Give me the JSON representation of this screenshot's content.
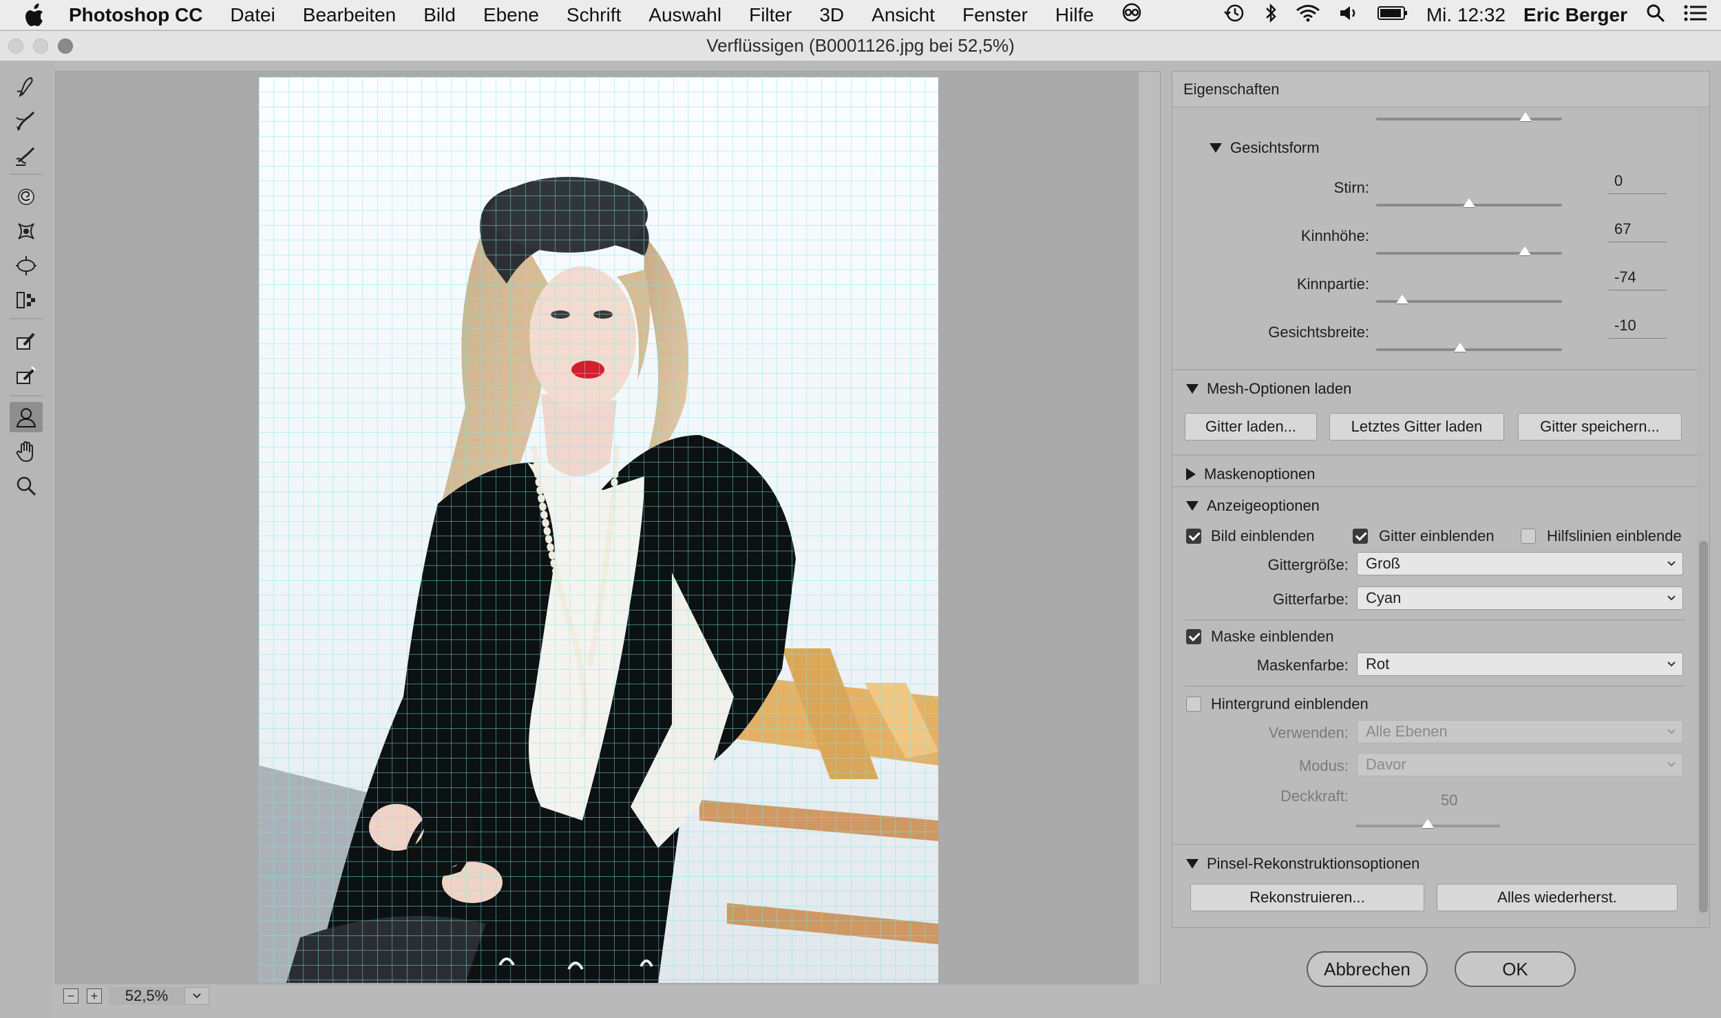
{
  "menubar": {
    "app_name": "Photoshop CC",
    "items": [
      "Datei",
      "Bearbeiten",
      "Bild",
      "Ebene",
      "Schrift",
      "Auswahl",
      "Filter",
      "3D",
      "Ansicht",
      "Fenster",
      "Hilfe"
    ],
    "clock": "Mi. 12:32",
    "user": "Eric Berger"
  },
  "window": {
    "title": "Verflüssigen (B0001126.jpg bei 52,5%)"
  },
  "tools": [
    "forward-warp-tool",
    "reconstruct-tool",
    "smooth-tool",
    "twirl-clockwise-tool",
    "pucker-tool",
    "bloat-tool",
    "push-left-tool",
    "freeze-mask-tool",
    "thaw-mask-tool",
    "face-tool",
    "hand-tool",
    "zoom-tool"
  ],
  "status": {
    "zoom": "52,5%"
  },
  "panel": {
    "title": "Eigenschaften",
    "face_shape": {
      "title": "Gesichtsform",
      "sliders": [
        {
          "label": "Stirn:",
          "value": "0",
          "level": 0.5
        },
        {
          "label": "Kinnhöhe:",
          "value": "67",
          "level": 0.8
        },
        {
          "label": "Kinnpartie:",
          "value": "-74",
          "level": 0.14
        },
        {
          "label": "Gesichtsbreite:",
          "value": "-10",
          "level": 0.45
        }
      ]
    },
    "mesh": {
      "title": "Mesh-Optionen laden",
      "buttons": [
        "Gitter laden...",
        "Letztes Gitter laden",
        "Gitter speichern..."
      ]
    },
    "mask_options": {
      "title": "Maskenoptionen"
    },
    "display": {
      "title": "Anzeigeoptionen",
      "show_image": {
        "label": "Bild einblenden",
        "checked": true
      },
      "show_mesh": {
        "label": "Gitter einblenden",
        "checked": true
      },
      "show_guides": {
        "label": "Hilfslinien einblende",
        "checked": false
      },
      "mesh_size": {
        "label": "Gittergröße:",
        "value": "Groß"
      },
      "mesh_color": {
        "label": "Gitterfarbe:",
        "value": "Cyan"
      },
      "show_mask": {
        "label": "Maske einblenden",
        "checked": true
      },
      "mask_color": {
        "label": "Maskenfarbe:",
        "value": "Rot"
      },
      "show_backdrop": {
        "label": "Hintergrund einblenden",
        "checked": false
      },
      "use": {
        "label": "Verwenden:",
        "value": "Alle Ebenen"
      },
      "mode": {
        "label": "Modus:",
        "value": "Davor"
      },
      "opacity": {
        "label": "Deckkraft:",
        "value": "50",
        "level": 0.5
      }
    },
    "brush_reconstruct": {
      "title": "Pinsel-Rekonstruktionsoptionen",
      "buttons": [
        "Rekonstruieren...",
        "Alles wiederherst."
      ]
    }
  },
  "dialog": {
    "cancel": "Abbrechen",
    "ok": "OK"
  },
  "colors": {
    "grid": "#7fe6ee",
    "mask": "#ff0000",
    "panel": "#bbbbbb"
  }
}
